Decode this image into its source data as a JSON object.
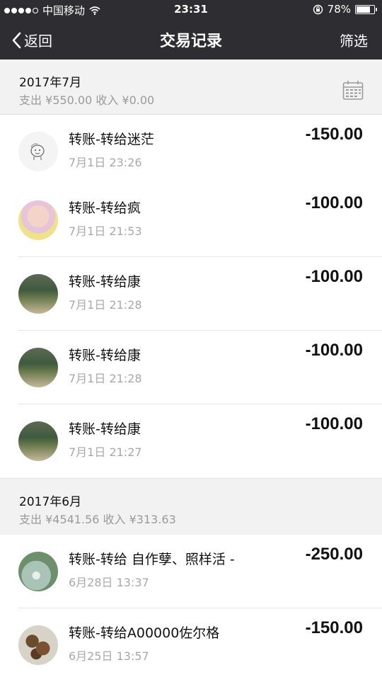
{
  "status_bar": {
    "carrier": "中国移动",
    "time": "23:31",
    "battery_percent": "78%",
    "battery_level": 0.78,
    "signal_dots_filled": 4,
    "signal_dots_total": 5
  },
  "nav": {
    "back_label": "返回",
    "title": "交易记录",
    "filter_label": "筛选"
  },
  "sections": [
    {
      "month": "2017年7月",
      "summary": "支出 ¥550.00 收入 ¥0.00",
      "show_calendar_icon": true,
      "rows": [
        {
          "title": "转账-转给迷茫",
          "date": "7月1日 23:26",
          "amount": "-150.00",
          "avatar": "sketch-avatar"
        },
        {
          "title": "转账-转给疯",
          "date": "7月1日 21:53",
          "amount": "-100.00",
          "avatar": "baby-photo-avatar"
        },
        {
          "title": "转账-转给康",
          "date": "7月1日 21:28",
          "amount": "-100.00",
          "avatar": "field-photo-avatar"
        },
        {
          "title": "转账-转给康",
          "date": "7月1日 21:28",
          "amount": "-100.00",
          "avatar": "field-photo-avatar"
        },
        {
          "title": "转账-转给康",
          "date": "7月1日 21:27",
          "amount": "-100.00",
          "avatar": "field-photo-avatar"
        }
      ]
    },
    {
      "month": "2017年6月",
      "summary": "支出 ¥4541.56 收入 ¥313.63",
      "show_calendar_icon": false,
      "rows": [
        {
          "title": "转账-转给 自作孽、照样活 -",
          "date": "6月28日 13:37",
          "amount": "-250.00",
          "avatar": "lake-photo-avatar"
        },
        {
          "title": "转账-转给A00000佐尔格",
          "date": "6月25日 13:57",
          "amount": "-150.00",
          "avatar": "stones-photo-avatar"
        }
      ]
    }
  ],
  "colors": {
    "bar_background": "#2e2e32",
    "section_background": "#f2f2f2",
    "secondary_text": "#a8a8a8"
  }
}
